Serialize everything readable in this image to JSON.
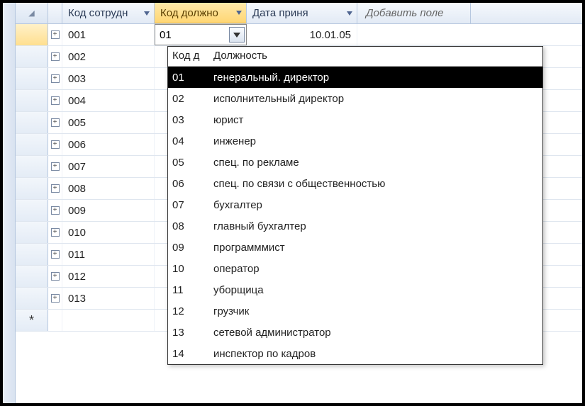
{
  "headers": {
    "employee_code": "Код сотрудн",
    "position_code": "Код должно",
    "hire_date": "Дата приня",
    "add_field": "Добавить поле"
  },
  "active_row": {
    "employee_code": "001",
    "position_code_input": "01",
    "hire_date": "10.01.05"
  },
  "rows": [
    {
      "code": "002"
    },
    {
      "code": "003"
    },
    {
      "code": "004"
    },
    {
      "code": "005"
    },
    {
      "code": "006"
    },
    {
      "code": "007"
    },
    {
      "code": "008"
    },
    {
      "code": "009"
    },
    {
      "code": "010"
    },
    {
      "code": "011"
    },
    {
      "code": "012"
    },
    {
      "code": "013"
    }
  ],
  "dropdown": {
    "col1": "Код д",
    "col2": "Должность",
    "selected_index": 0,
    "items": [
      {
        "code": "01",
        "label": "генеральный. директор"
      },
      {
        "code": "02",
        "label": "исполнительный директор"
      },
      {
        "code": "03",
        "label": "юрист"
      },
      {
        "code": "04",
        "label": "инженер"
      },
      {
        "code": "05",
        "label": "спец. по рекламе"
      },
      {
        "code": "06",
        "label": "спец. по связи с общественностью"
      },
      {
        "code": "07",
        "label": "бухгалтер"
      },
      {
        "code": "08",
        "label": "главный бухгалтер"
      },
      {
        "code": "09",
        "label": "программмист"
      },
      {
        "code": "10",
        "label": "оператор"
      },
      {
        "code": "11",
        "label": "уборщица"
      },
      {
        "code": "12",
        "label": "грузчик"
      },
      {
        "code": "13",
        "label": "сетевой администратор"
      },
      {
        "code": "14",
        "label": "инспектор по кадров"
      }
    ]
  }
}
